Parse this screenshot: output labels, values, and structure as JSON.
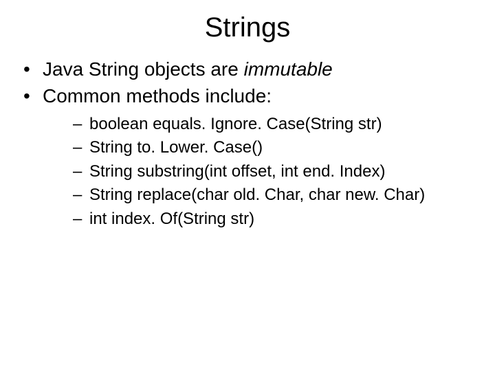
{
  "title": "Strings",
  "bullets": [
    {
      "prefix": "Java String objects are ",
      "emphasis": "immutable",
      "suffix": ""
    },
    {
      "prefix": "Common methods include:",
      "emphasis": "",
      "suffix": ""
    }
  ],
  "sub_bullets": [
    "boolean equals. Ignore. Case(String str)",
    "String to. Lower. Case()",
    "String substring(int offset, int end. Index)",
    "String replace(char old. Char, char new. Char)",
    "int index. Of(String str)"
  ]
}
